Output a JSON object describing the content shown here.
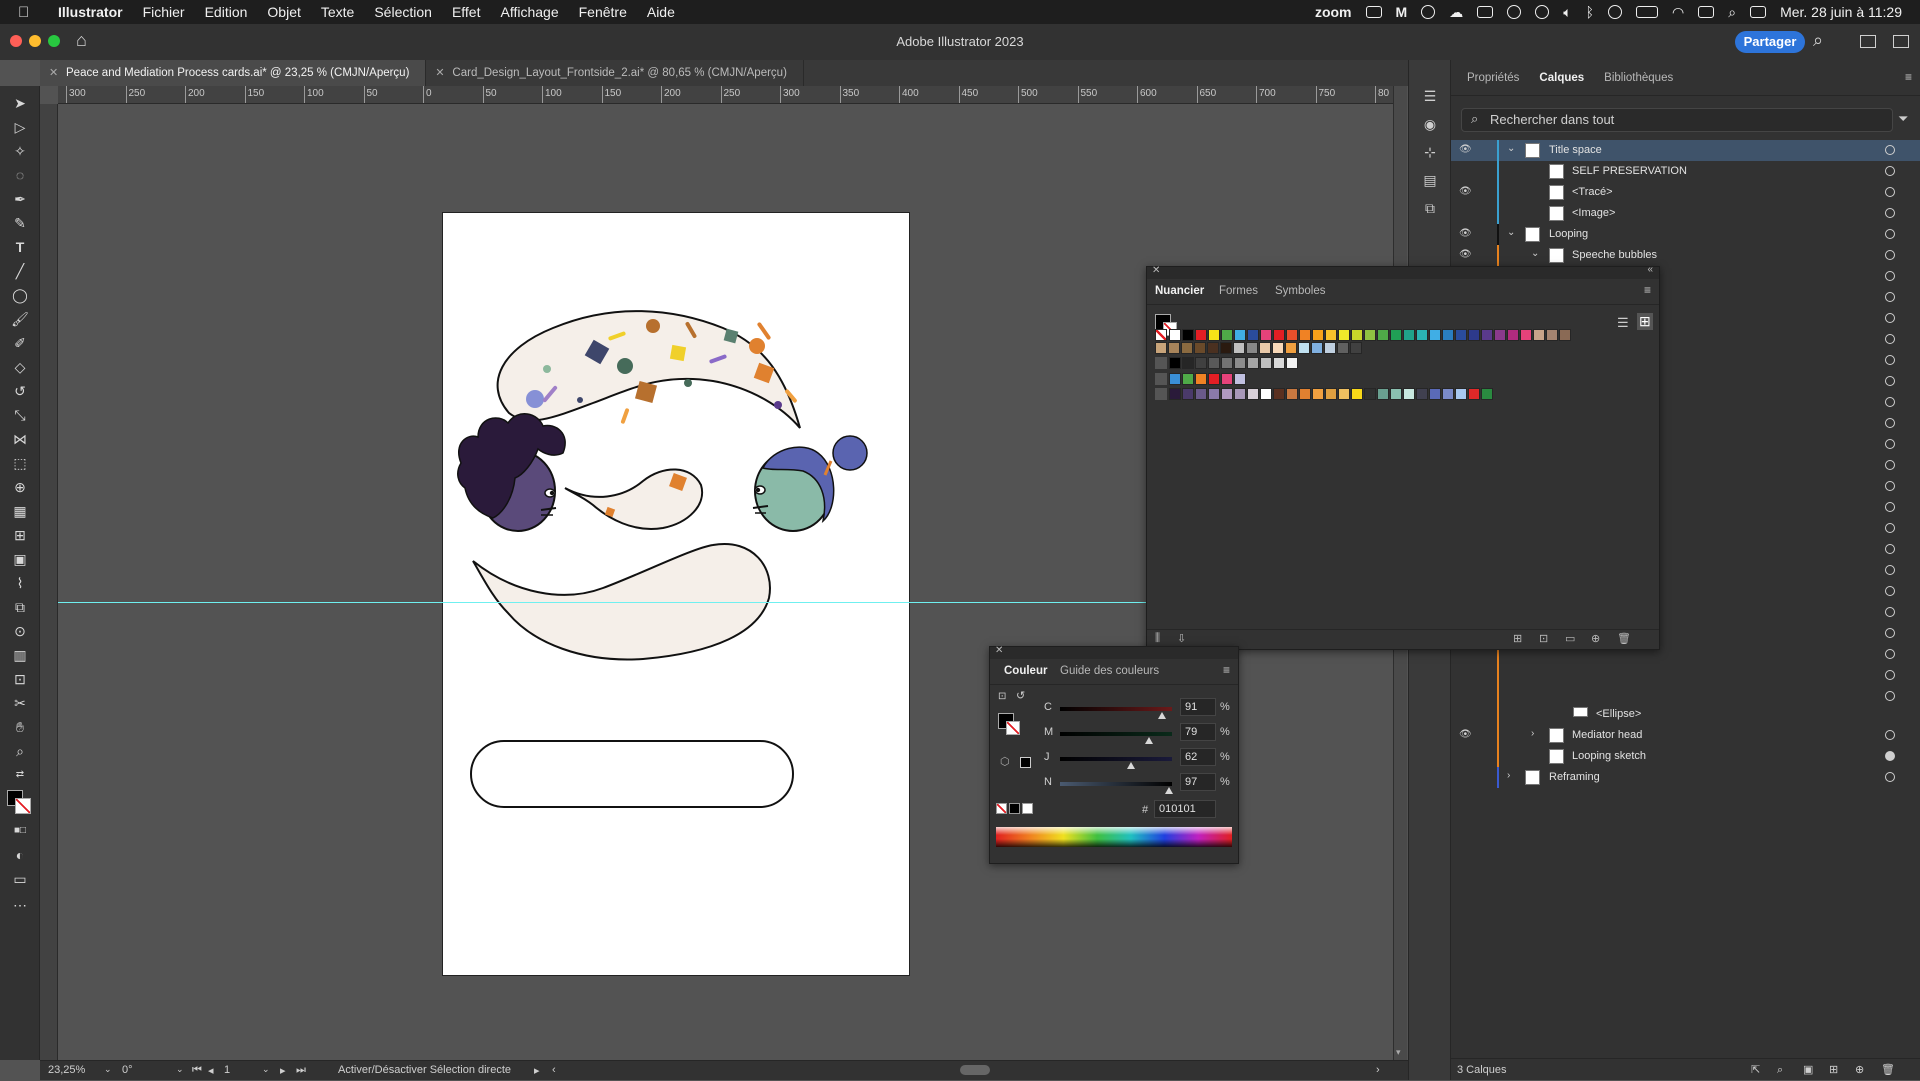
{
  "menubar": {
    "app": "Illustrator",
    "items": [
      "Fichier",
      "Edition",
      "Objet",
      "Texte",
      "Sélection",
      "Effet",
      "Affichage",
      "Fenêtre",
      "Aide"
    ],
    "zoom": "zoom",
    "datetime": "Mer. 28 juin à 11:29"
  },
  "window": {
    "title": "Adobe Illustrator 2023",
    "share_label": "Partager"
  },
  "tabs": [
    {
      "label": "Peace and Mediation Process cards.ai* @ 23,25 % (CMJN/Aperçu)"
    },
    {
      "label": "Card_Design_Layout_Frontside_2.ai* @ 80,65 % (CMJN/Aperçu)"
    }
  ],
  "ruler": {
    "labels": [
      "300",
      "250",
      "200",
      "150",
      "100",
      "50",
      "0",
      "50",
      "100",
      "150",
      "200",
      "250",
      "300",
      "350",
      "400",
      "450",
      "500",
      "550",
      "600",
      "650",
      "700",
      "750",
      "80"
    ]
  },
  "layers_panel": {
    "tabs": [
      "Propriétés",
      "Calques",
      "Bibliothèques"
    ],
    "search_placeholder": "Rechercher dans tout",
    "rows": [
      {
        "name": "Title space",
        "visible": true
      },
      {
        "name": "SELF PRESERVATION",
        "visible": false
      },
      {
        "name": "<Tracé>",
        "visible": true
      },
      {
        "name": "<Image>",
        "visible": false
      },
      {
        "name": "Looping",
        "visible": true
      },
      {
        "name": "Speeche bubbles",
        "visible": true
      },
      {
        "name": "<Ellipse>",
        "visible": false
      },
      {
        "name": "Mediator head",
        "visible": true
      },
      {
        "name": "Looping sketch",
        "visible": false
      },
      {
        "name": "Reframing",
        "visible": false
      }
    ],
    "footer": "3 Calques"
  },
  "swatches_panel": {
    "tabs": [
      "Nuancier",
      "Formes",
      "Symboles"
    ],
    "row1": [
      "#ffffff",
      "#000000",
      "#e31e24",
      "#f7e318",
      "#4faa48",
      "#40aee5",
      "#2a4c9c",
      "#e6427a",
      "#e31e24",
      "#e94f2b",
      "#f08224",
      "#f6a11a",
      "#f8c12b",
      "#f0e92a",
      "#c8d52a",
      "#8fc342",
      "#4faa48",
      "#20a055",
      "#20a28a",
      "#2bb3b3",
      "#40aee5",
      "#2a7ec0",
      "#2a4c9c",
      "#2d3a8c",
      "#5a3a8c",
      "#8a3a8c",
      "#b02b7e",
      "#e6427a",
      "#c8a48a",
      "#a58470",
      "#8a6a55"
    ],
    "row2": [
      "#c8a47a",
      "#a8845a",
      "#8a6a40",
      "#6a4a2a",
      "#4a3020",
      "#2a1a10",
      "#c0c0c0",
      "#888888",
      "#e8c8a8",
      "#f8d8b8",
      "#f0a040",
      "#c0e0f0",
      "#80b0e0",
      "#c0d0e0",
      "#606060",
      "#404040"
    ],
    "row3": [
      "#000000",
      "#262626",
      "#404040",
      "#595959",
      "#737373",
      "#8c8c8c",
      "#a6a6a6",
      "#bfbfbf",
      "#d9d9d9",
      "#f2f2f2"
    ],
    "row4": [
      "#3a8fd6",
      "#4faa48",
      "#f08224",
      "#e31e24",
      "#e6427a",
      "#c0c0e0"
    ],
    "row5": [
      "#2a1a3a",
      "#4a3a6a",
      "#6a5a8a",
      "#8a7aaa",
      "#b09ac0",
      "#a898b8",
      "#d8d0d8",
      "#ffffff",
      "#5a3020",
      "#c87840",
      "#e08030",
      "#f0a040",
      "#e0a040",
      "#f0c060",
      "#f8d818",
      "#303030",
      "#6aa090",
      "#8ac0b0",
      "#c8e8e0",
      "#404050",
      "#5a6ab8",
      "#7a8ac8",
      "#a8c8f0",
      "#e02828",
      "#2a8a40"
    ]
  },
  "color_panel": {
    "tabs": [
      "Couleur",
      "Guide des couleurs"
    ],
    "channels": [
      {
        "label": "C",
        "value": "91",
        "pct": 0.91
      },
      {
        "label": "M",
        "value": "79",
        "pct": 0.79
      },
      {
        "label": "J",
        "value": "62",
        "pct": 0.62
      },
      {
        "label": "N",
        "value": "97",
        "pct": 0.97
      }
    ],
    "hex_label": "#",
    "hex": "010101",
    "percent_sign": "%"
  },
  "status": {
    "zoom": "23,25%",
    "rotation": "0°",
    "artboard": "1",
    "message": "Activer/Désactiver Sélection directe"
  }
}
